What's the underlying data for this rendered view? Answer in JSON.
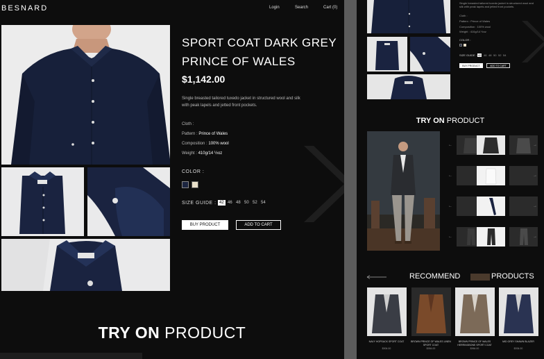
{
  "header": {
    "brand": "BESNARD",
    "nav": [
      "Login",
      "Search",
      "Cart (0)"
    ]
  },
  "product": {
    "title": "SPORT COAT DARK GREY PRINCE OF WALES",
    "price": "$1,142.00",
    "description": "Single breasted tailored tuxedo jacket in structured wool and silk with peak lapels and jetted front pockets.",
    "specs": [
      {
        "label": "Cloth :",
        "value": ""
      },
      {
        "label": "Pattern : ",
        "value": "Prince of Wales"
      },
      {
        "label": "Composition : ",
        "value": "100% wool"
      },
      {
        "label": "Weight : ",
        "value": "410g/14 ½oz"
      }
    ],
    "color_label": "COLOR :",
    "colors": [
      "#1c2540",
      "#e8dfc9"
    ],
    "size_label": "SIZE GUIDE :",
    "sizes": [
      "42",
      "46",
      "48",
      "50",
      "52",
      "54"
    ],
    "selected_size": "42",
    "buy_label": "BUY PRODUCT",
    "cart_label": "ADD TO CART"
  },
  "tryon": {
    "bold": "TRY ON",
    "light": " PRODUCT"
  },
  "right_panel": {
    "mini_specs": [
      "Cloth :",
      "Pattern : Prince of Wales",
      "Composition : 100% wool",
      "Weight : 410g/14 ½oz"
    ],
    "mini_desc": "Single breasted tailored tuxedo jacket in structured wool and silk with peak lapels and jetted front pockets.",
    "color_label": "COLOR :",
    "size_label": "SIZE GUIDE :",
    "sizes": [
      "42",
      "46",
      "48",
      "50",
      "52",
      "54"
    ],
    "buy_label": "BUY PRODUCT",
    "cart_label": "ADD TO CART",
    "tryon_bold": "TRY ON",
    "tryon_light": " PRODUCT",
    "recommend_bold": "RECOMMEND",
    "recommend_light": "PRODUCTS",
    "recommendations": [
      {
        "name": "NAVY HOPSACK SPORT COAT",
        "price": "$904.00",
        "color": "#3a3d45"
      },
      {
        "name": "BROWN PRINCE OF WALES LINEN SPORT COAT",
        "price": "$954.00",
        "color": "#7a4a2a"
      },
      {
        "name": "BROWN PRINCE OF WALES HERRINGBONE SPORT COAT",
        "price": "$964.00",
        "color": "#7c6a58"
      },
      {
        "name": "MID GREY SHAWN BLAZER",
        "price": "$934.00",
        "color": "#2a3352"
      }
    ]
  }
}
